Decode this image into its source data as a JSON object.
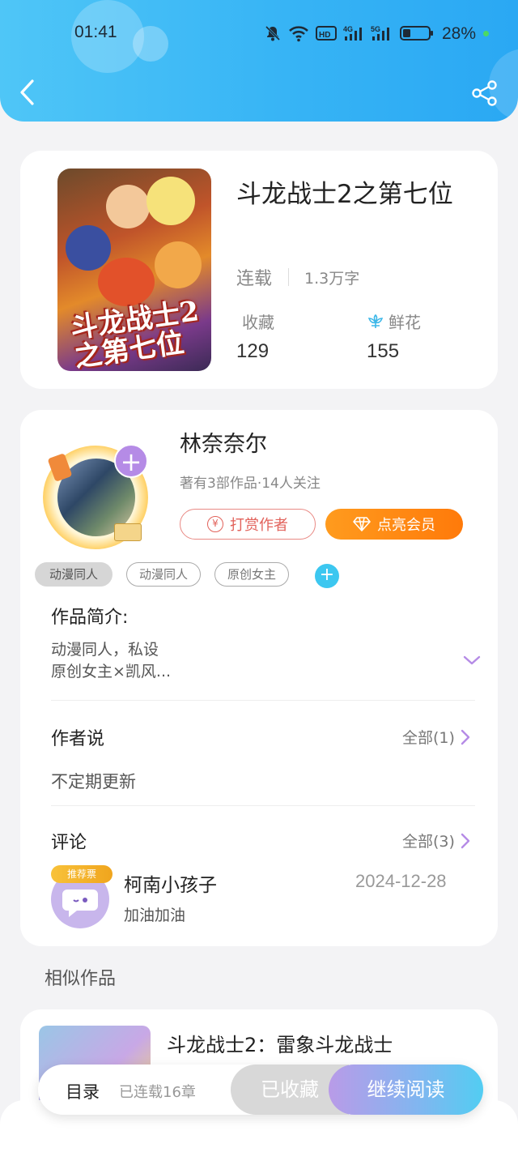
{
  "status_bar": {
    "time": "01:41",
    "battery": "28%"
  },
  "book": {
    "title": "斗龙战士2之第七位",
    "cover_text": "斗龙战士2之第七位",
    "status": "连载",
    "words": "1.3万字",
    "collect_label": "收藏",
    "collect_count": "129",
    "flower_label": "鲜花",
    "flower_count": "155"
  },
  "author": {
    "name": "林奈奈尔",
    "meta": "著有3部作品·14人关注",
    "tip_label": "打赏作者",
    "vip_label": "点亮会员"
  },
  "tags": [
    "动漫同人",
    "动漫同人",
    "原创女主"
  ],
  "intro": {
    "title": "作品简介:",
    "line1": "动漫同人，私设",
    "line2": "原创女主×凯风..."
  },
  "author_says": {
    "title": "作者说",
    "more": "全部(1)",
    "text": "不定期更新"
  },
  "comments": {
    "title": "评论",
    "more": "全部(3)",
    "items": [
      {
        "badge": "推荐票",
        "user": "柯南小孩子",
        "date": "2024-12-28",
        "text": "加油加油"
      }
    ]
  },
  "similar": {
    "label": "相似作品",
    "items": [
      {
        "title": "斗龙战士2：雷象斗龙战士"
      }
    ]
  },
  "bottom_bar": {
    "toc": "目录",
    "chapters": "已连载16章",
    "favorited": "已收藏",
    "continue": "继续阅读"
  },
  "colors": {
    "header": "#37b4f5",
    "accent_purple": "#b58be6",
    "vip_orange": "#ff8a14",
    "tip_red": "#e2625b"
  },
  "icons": [
    "back-arrow-icon",
    "share-icon",
    "flower-icon",
    "plus-icon",
    "yen-icon",
    "diamond-icon",
    "chevron-down-icon",
    "chevron-right-icon"
  ]
}
